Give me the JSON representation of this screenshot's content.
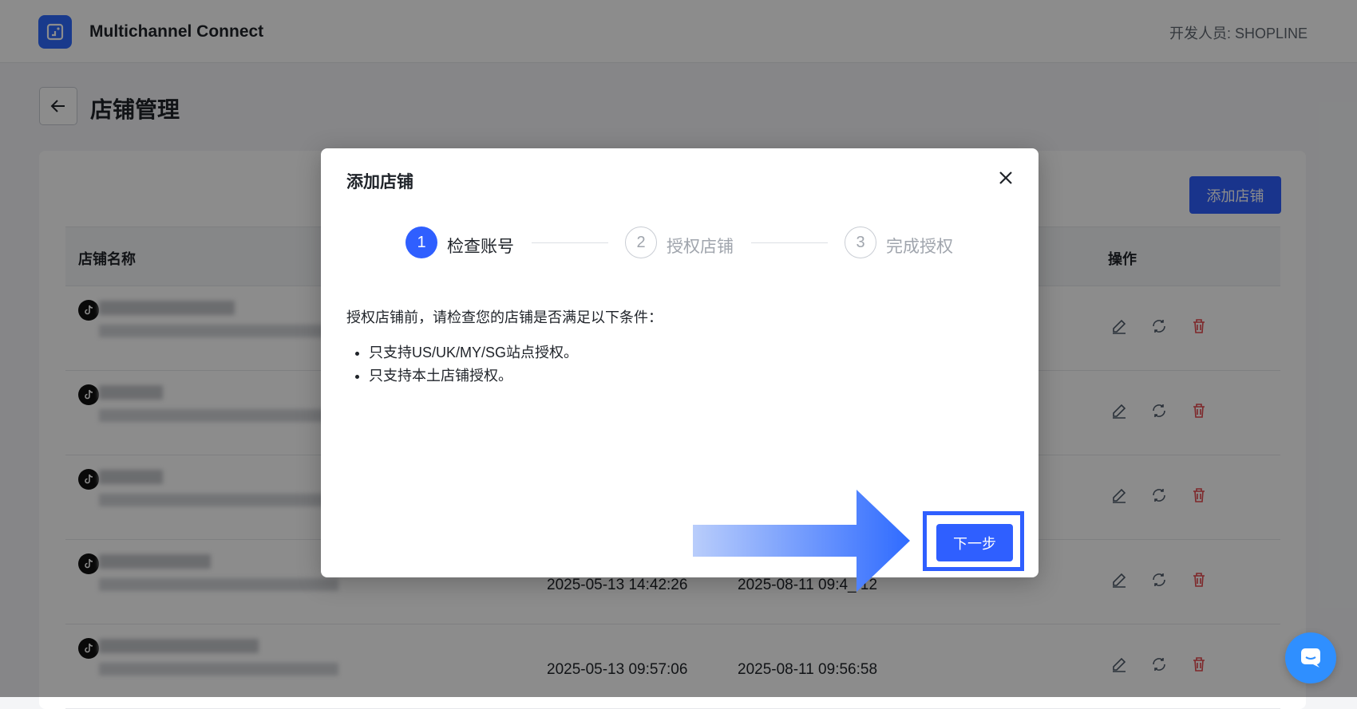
{
  "header": {
    "app_name": "Multichannel Connect",
    "developer": "开发人员: SHOPLINE"
  },
  "page": {
    "title": "店铺管理",
    "add_store_label": "添加店铺"
  },
  "table": {
    "columns": {
      "store_name": "店铺名称",
      "actions": "操作"
    },
    "rows": [
      {
        "created": "",
        "updated": ""
      },
      {
        "created": "",
        "updated": ""
      },
      {
        "created": "",
        "updated": ""
      },
      {
        "created": "2025-05-13 14:42:26",
        "updated": "2025-08-11 09:4_:12"
      },
      {
        "created": "2025-05-13 09:57:06",
        "updated": "2025-08-11 09:56:58"
      }
    ]
  },
  "modal": {
    "title": "添加店铺",
    "steps": [
      {
        "number": "1",
        "label": "检查账号"
      },
      {
        "number": "2",
        "label": "授权店铺"
      },
      {
        "number": "3",
        "label": "完成授权"
      }
    ],
    "intro": "授权店铺前，请检查您的店铺是否满足以下条件：",
    "conditions": [
      "只支持US/UK/MY/SG站点授权。",
      "只支持本土店铺授权。"
    ],
    "next_label": "下一步"
  },
  "colors": {
    "primary": "#2f5fff",
    "delete": "#e5484d"
  }
}
